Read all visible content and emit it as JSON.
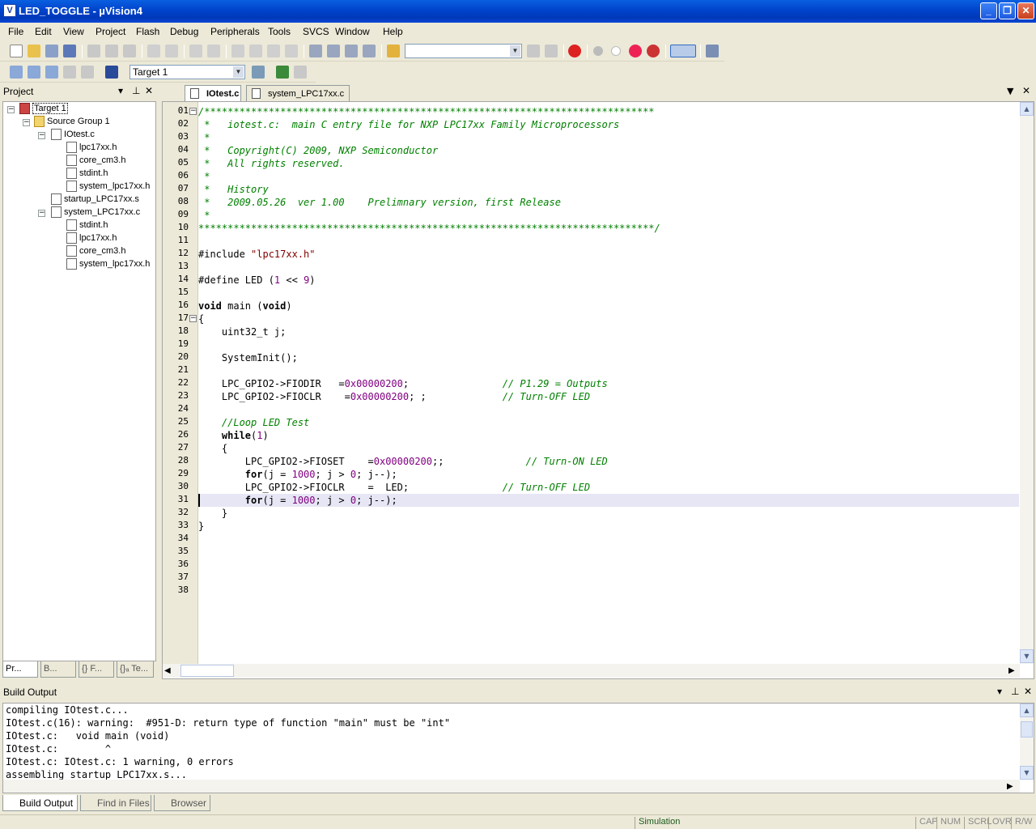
{
  "window": {
    "title": "LED_TOGGLE  - µVision4",
    "app_icon": "V"
  },
  "menu": [
    "File",
    "Edit",
    "View",
    "Project",
    "Flash",
    "Debug",
    "Peripherals",
    "Tools",
    "SVCS",
    "Window",
    "Help"
  ],
  "toolbar2": {
    "target": "Target 1"
  },
  "project": {
    "header": "Project",
    "tree": [
      {
        "label": "Target 1",
        "icon": "target-icon"
      },
      {
        "label": "Source Group 1",
        "icon": "folder-icon"
      },
      {
        "label": "IOtest.c",
        "icon": "c-file-icon"
      },
      {
        "label": "lpc17xx.h",
        "icon": "h-file-icon"
      },
      {
        "label": "core_cm3.h",
        "icon": "h-file-icon"
      },
      {
        "label": "stdint.h",
        "icon": "h-file-icon"
      },
      {
        "label": "system_lpc17xx.h",
        "icon": "h-file-icon"
      },
      {
        "label": "startup_LPC17xx.s",
        "icon": "asm-file-icon"
      },
      {
        "label": "system_LPC17xx.c",
        "icon": "c-file-icon"
      },
      {
        "label": "stdint.h",
        "icon": "h-file-icon"
      },
      {
        "label": "lpc17xx.h",
        "icon": "h-file-icon"
      },
      {
        "label": "core_cm3.h",
        "icon": "h-file-icon"
      },
      {
        "label": "system_lpc17xx.h",
        "icon": "h-file-icon"
      }
    ],
    "bottom_tabs": [
      "Pr...",
      "B...",
      "{} F...",
      "{}ₐ Te..."
    ]
  },
  "editor": {
    "tabs": [
      "IOtest.c",
      "system_LPC17xx.c"
    ],
    "line_numbers": [
      "01",
      "02",
      "03",
      "04",
      "05",
      "06",
      "07",
      "08",
      "09",
      "10",
      "11",
      "12",
      "13",
      "14",
      "15",
      "16",
      "17",
      "18",
      "19",
      "20",
      "21",
      "22",
      "23",
      "24",
      "25",
      "26",
      "27",
      "28",
      "29",
      "30",
      "31",
      "32",
      "33",
      "34",
      "35",
      "36",
      "37",
      "38"
    ],
    "lines": [
      "/*****************************************************************************",
      " *   iotest.c:  main C entry file for NXP LPC17xx Family Microprocessors",
      " *",
      " *   Copyright(C) 2009, NXP Semiconductor",
      " *   All rights reserved.",
      " *",
      " *   History",
      " *   2009.05.26  ver 1.00    Prelimnary version, first Release",
      " *",
      "******************************************************************************/",
      "",
      "#include \"lpc17xx.h\"",
      "",
      "#define LED (1 << 9)",
      "",
      "void main (void)",
      "{",
      "    uint32_t j;",
      "",
      "    SystemInit();",
      "",
      "    LPC_GPIO2->FIODIR   =0x00000200;                // P1.29 = Outputs",
      "    LPC_GPIO2->FIOCLR    =0x00000200; ;             // Turn-OFF LED",
      "",
      "    //Loop LED Test",
      "    while(1)",
      "    {",
      "        LPC_GPIO2->FIOSET    =0x00000200;;              // Turn-ON LED",
      "        for(j = 1000; j > 0; j--);",
      "        LPC_GPIO2->FIOCLR    =  LED;                // Turn-OFF LED",
      "        for(j = 1000; j > 0; j--);",
      "    }",
      "}",
      "",
      "",
      "",
      "",
      ""
    ]
  },
  "build": {
    "header": "Build Output",
    "lines": [
      "compiling IOtest.c...",
      "IOtest.c(16): warning:  #951-D: return type of function \"main\" must be \"int\"",
      "IOtest.c:   void main (void)",
      "IOtest.c:        ^",
      "IOtest.c: IOtest.c: 1 warning, 0 errors",
      "assembling startup_LPC17xx.s..."
    ],
    "tabs": [
      "Build Output",
      "Find in Files",
      "Browser"
    ]
  },
  "status": {
    "mode": "Simulation",
    "cap": "CAP",
    "num": "NUM",
    "scrl": "SCRL",
    "ovr": "OVR",
    "rw": "R/W"
  }
}
